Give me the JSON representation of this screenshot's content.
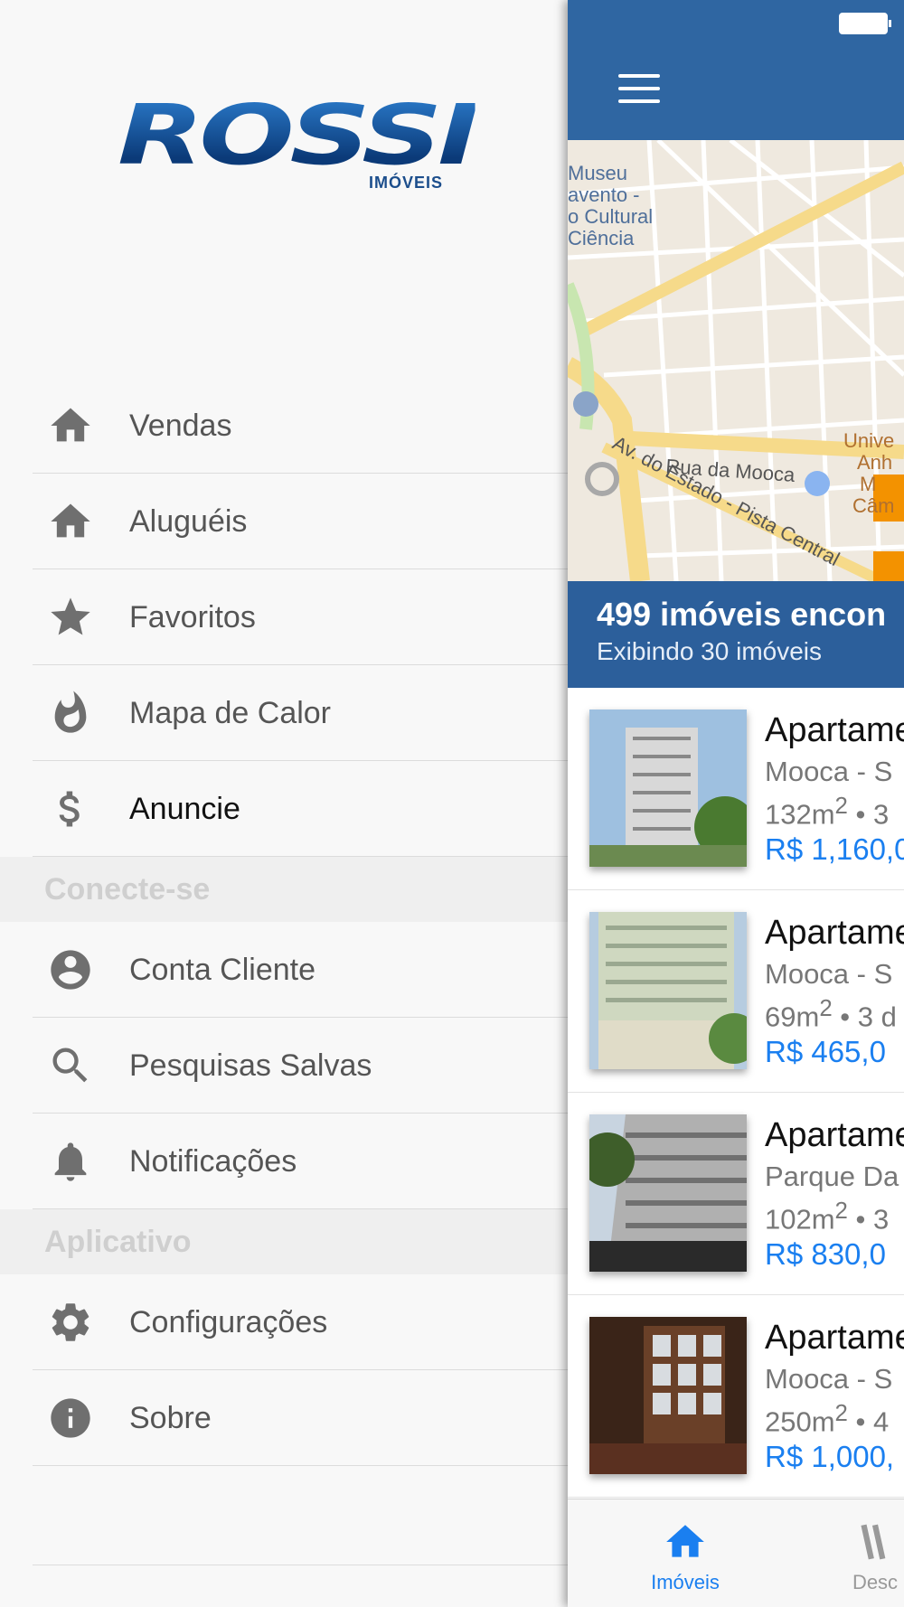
{
  "drawer": {
    "logo": {
      "word": "ROSSI",
      "subtitle": "IMÓVEIS"
    },
    "items": [
      {
        "label": "Vendas",
        "icon": "home-icon"
      },
      {
        "label": "Aluguéis",
        "icon": "home-icon"
      },
      {
        "label": "Favoritos",
        "icon": "star-icon"
      },
      {
        "label": "Mapa de Calor",
        "icon": "flame-icon"
      },
      {
        "label": "Anuncie",
        "icon": "dollar-icon"
      }
    ],
    "section_connect": "Conecte-se",
    "connect_items": [
      {
        "label": "Conta Cliente",
        "icon": "account-icon"
      },
      {
        "label": "Pesquisas Salvas",
        "icon": "search-icon"
      },
      {
        "label": "Notificações",
        "icon": "bell-icon"
      }
    ],
    "section_app": "Aplicativo",
    "app_items": [
      {
        "label": "Configurações",
        "icon": "gear-icon"
      },
      {
        "label": "Sobre",
        "icon": "info-icon"
      }
    ]
  },
  "map": {
    "labels": [
      "Museu",
      "avento -",
      "o Cultural",
      "Ciência",
      "Rua da Mooca",
      "Av. do Estado - Pista Central",
      "Unive",
      "Anh",
      "M",
      "Câm"
    ]
  },
  "results": {
    "count": "499 imóveis encon",
    "showing": "Exibindo 30 imóveis"
  },
  "listings": [
    {
      "title": "Apartame",
      "location": "Mooca - S",
      "area": "132m",
      "sup": "2",
      "rest": " • 3",
      "price": "R$ 1,160,0"
    },
    {
      "title": "Apartame",
      "location": "Mooca - S",
      "area": "69m",
      "sup": "2",
      "rest": " • 3 d",
      "price": "R$ 465,0"
    },
    {
      "title": "Apartame",
      "location": "Parque Da",
      "area": "102m",
      "sup": "2",
      "rest": " • 3",
      "price": "R$ 830,0"
    },
    {
      "title": "Apartame",
      "location": "Mooca - S",
      "area": "250m",
      "sup": "2",
      "rest": " • 4",
      "price": "R$ 1,000,"
    }
  ],
  "tabbar": {
    "tabs": [
      {
        "label": "Imóveis",
        "icon": "home-icon"
      },
      {
        "label": "Desc",
        "icon": "highlight-icon"
      }
    ]
  },
  "colors": {
    "navbar": "#2f66a2",
    "accent": "#1a7ff0",
    "results_bar": "#2c5f9b",
    "marker": "#f39200"
  }
}
